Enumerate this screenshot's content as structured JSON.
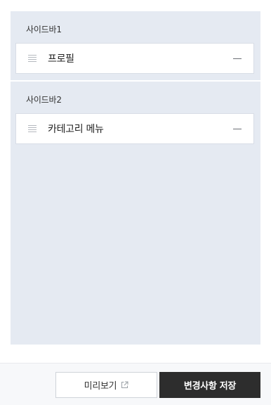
{
  "sidebar1": {
    "title": "사이드바1",
    "items": [
      {
        "label": "프로필",
        "icon": "drag-handle-icon",
        "action_icon": "collapse-icon"
      }
    ]
  },
  "sidebar2": {
    "title": "사이드바2",
    "items": [
      {
        "label": "카테고리 메뉴",
        "icon": "drag-handle-icon",
        "action_icon": "collapse-icon"
      }
    ]
  },
  "footer": {
    "preview_label": "미리보기",
    "preview_icon": "external-link-icon",
    "save_label": "변경사항 저장"
  },
  "colors": {
    "panel_background": "#e5eaf2",
    "save_button": "#2d2d2d"
  }
}
